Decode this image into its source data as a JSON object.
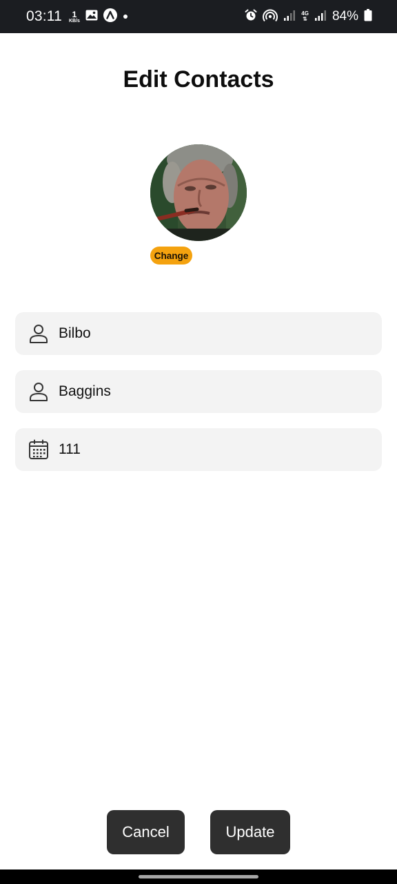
{
  "status_bar": {
    "time": "03:11",
    "net_speed_value": "1",
    "net_speed_unit": "KB/s",
    "network_type": "4G",
    "battery_percent": "84%",
    "icons": [
      "image-icon",
      "app-a-icon",
      "dot-icon",
      "alarm-icon",
      "hotspot-icon",
      "signal-icon",
      "battery-icon"
    ]
  },
  "header": {
    "title": "Edit Contacts"
  },
  "avatar": {
    "change_label": "Change"
  },
  "form": {
    "first_name": "Bilbo",
    "last_name": "Baggins",
    "date_field": "111"
  },
  "actions": {
    "cancel_label": "Cancel",
    "update_label": "Update"
  },
  "colors": {
    "accent": "#f4a20f",
    "button_bg": "#2f2f2f",
    "field_bg": "#f3f3f3",
    "status_bar_bg": "#1b1d21"
  }
}
